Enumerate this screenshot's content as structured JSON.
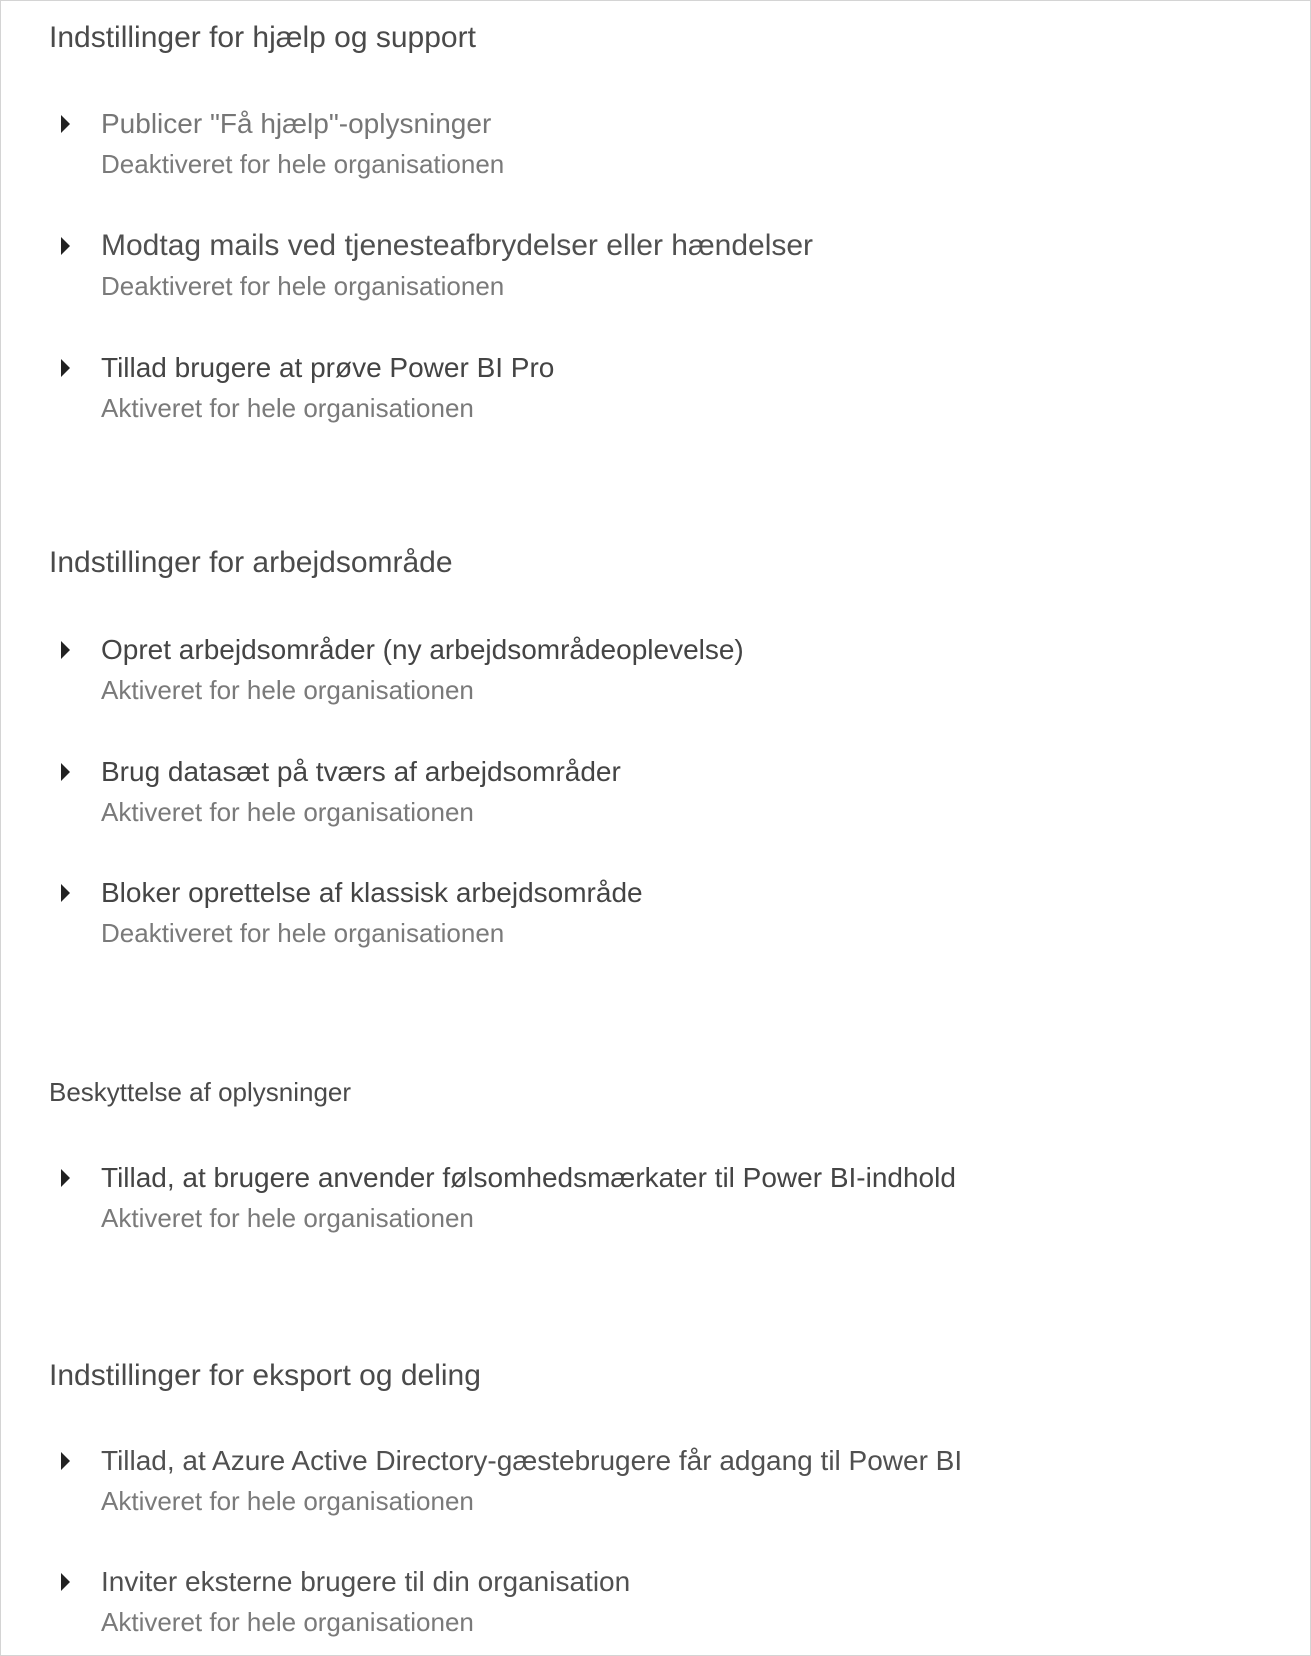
{
  "sections": [
    {
      "title": "Indstillinger for hjælp og support",
      "items": [
        {
          "title": "Publicer \"Få hjælp\"-oplysninger",
          "status": "Deaktiveret for hele organisationen"
        },
        {
          "title": "Modtag mails ved tjenesteafbrydelser eller hændelser",
          "status": "Deaktiveret for hele organisationen"
        },
        {
          "title": "Tillad brugere at prøve Power BI Pro",
          "status": "Aktiveret for hele organisationen"
        }
      ]
    },
    {
      "title": "Indstillinger for arbejdsområde",
      "items": [
        {
          "title": "Opret arbejdsområder (ny arbejdsområdeoplevelse)",
          "status": "Aktiveret for hele organisationen"
        },
        {
          "title": "Brug datasæt på tværs af arbejdsområder",
          "status": "Aktiveret for hele organisationen"
        },
        {
          "title": "Bloker oprettelse af klassisk arbejdsområde",
          "status": "Deaktiveret for hele organisationen"
        }
      ]
    },
    {
      "title": "Beskyttelse af oplysninger",
      "items": [
        {
          "title": "Tillad, at brugere anvender følsomhedsmærkater til Power BI-indhold",
          "status": "Aktiveret for hele organisationen"
        }
      ]
    },
    {
      "title": "Indstillinger for eksport og deling",
      "items": [
        {
          "title": "Tillad, at Azure Active Directory-gæstebrugere får adgang til Power BI",
          "status": "Aktiveret for hele organisationen"
        },
        {
          "title": "Inviter eksterne brugere til din organisation",
          "status": "Aktiveret for hele organisationen"
        }
      ]
    }
  ],
  "icons": {
    "expand": "caret-right-icon"
  }
}
